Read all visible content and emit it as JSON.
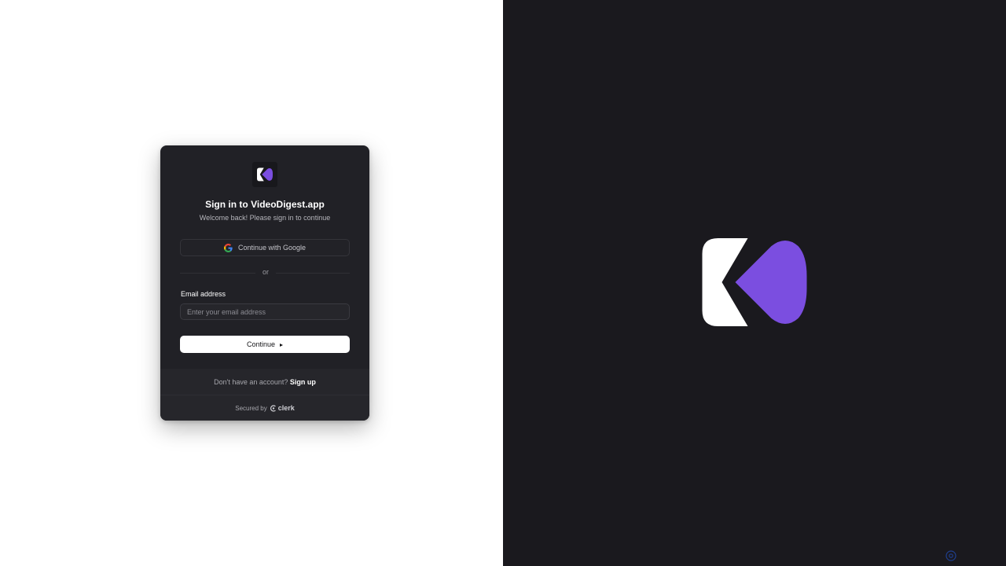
{
  "app": {
    "name": "VideoDigest.app"
  },
  "colors": {
    "brand_purple": "#7b4ee0",
    "card_bg": "#212126",
    "right_panel_bg": "#1a191e",
    "left_panel_bg": "#ffffff"
  },
  "signin": {
    "title": "Sign in to VideoDigest.app",
    "subtitle": "Welcome back! Please sign in to continue",
    "google_button_label": "Continue with Google",
    "divider_text": "or",
    "email_label": "Email address",
    "email_placeholder": "Enter your email address",
    "email_value": "",
    "continue_label": "Continue"
  },
  "footer": {
    "signup_prompt": "Don't have an account?",
    "signup_link": "Sign up",
    "secured_by": "Secured by",
    "provider": "clerk"
  },
  "icons": {
    "card_logo": "videodigest-logo-icon",
    "google": "google-icon",
    "continue_arrow": "play-arrow-icon",
    "clerk": "clerk-logo-icon",
    "hero": "videodigest-logo-icon",
    "corner": "settings-icon"
  }
}
